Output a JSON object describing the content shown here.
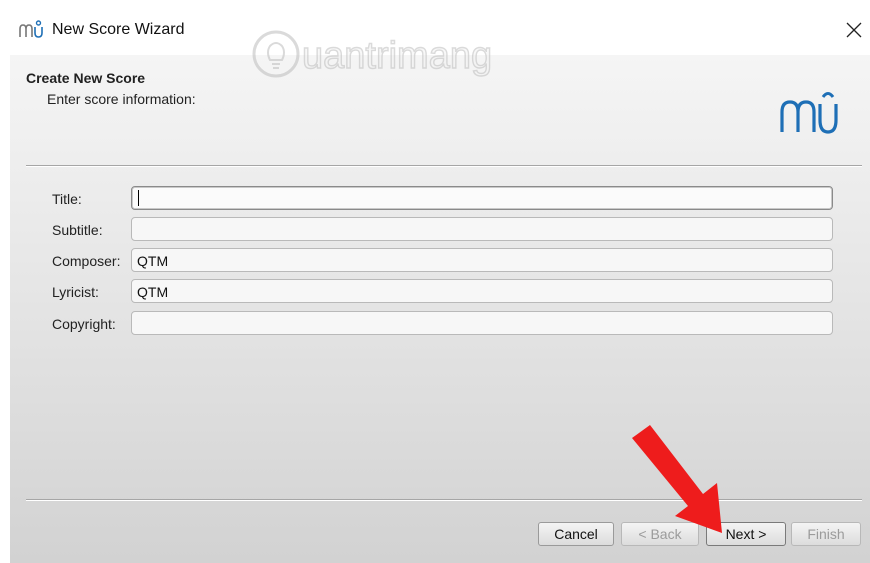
{
  "window": {
    "title": "New Score Wizard",
    "close_glyph": "✕"
  },
  "header": {
    "title": "Create New Score",
    "subtitle": "Enter score information:"
  },
  "form": {
    "fields": [
      {
        "label": "Title:",
        "value": ""
      },
      {
        "label": "Subtitle:",
        "value": ""
      },
      {
        "label": "Composer:",
        "value": "QTM"
      },
      {
        "label": "Lyricist:",
        "value": "QTM"
      },
      {
        "label": "Copyright:",
        "value": ""
      }
    ]
  },
  "buttons": {
    "cancel": "Cancel",
    "back": "< Back",
    "next": "Next >",
    "finish": "Finish"
  },
  "watermark": {
    "text": "uantrimang"
  },
  "icons": {
    "app": "musescore-icon",
    "logo": "musescore-logo",
    "close": "close-icon",
    "annotation": "red-arrow"
  },
  "colors": {
    "logo_blue": "#1e6fb6",
    "arrow_red": "#ee1c1c"
  }
}
